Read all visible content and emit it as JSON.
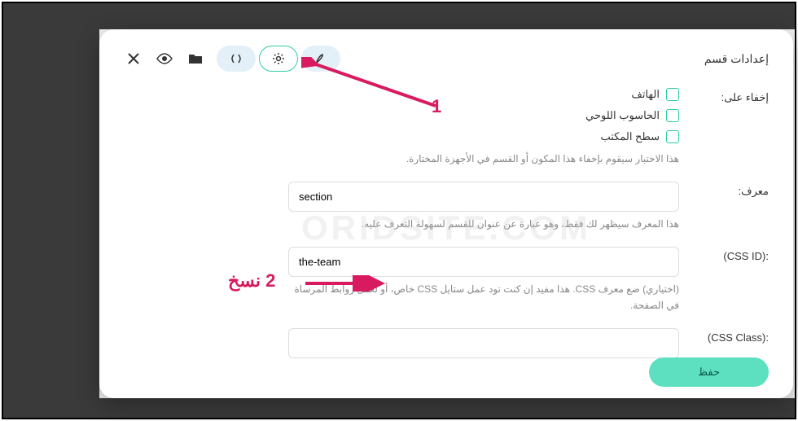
{
  "title": "إعدادات قسم",
  "hideOn": {
    "label": "إخفاء على:",
    "options": [
      "الهاتف",
      "الحاسوب اللوحي",
      "سطح المكتب"
    ],
    "helper": "هذا الاختبار سيقوم بإخفاء هذا المكون أو القسم في الأجهزة المختارة."
  },
  "identifier": {
    "label": "معرف:",
    "value": "section",
    "helper": "هذا المعرف سيظهر لك فقط، وهو عبارة عن عنوان للقسم لسهولة التعرف عليه."
  },
  "cssId": {
    "label": ":(CSS ID)",
    "value": "the-team",
    "helper": "(اختياري) ضع معرف CSS. هذا مفيد إن كنت تود عمل ستايل CSS خاص، أو لعمل روابط المرساة في الصفحة."
  },
  "cssClass": {
    "label": ":(CSS Class)",
    "value": ""
  },
  "saveLabel": "حفظ",
  "watermark": "ORIDSITE.COM",
  "anno": {
    "one": "1",
    "two": "2 نسخ"
  }
}
